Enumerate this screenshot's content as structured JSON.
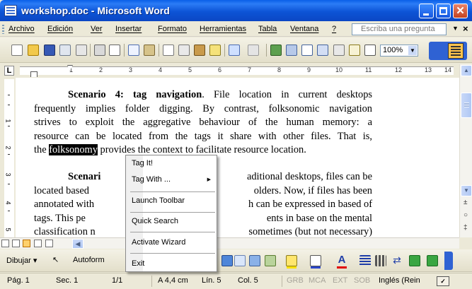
{
  "window": {
    "title": "workshop.doc - Microsoft Word"
  },
  "menubar": {
    "items": [
      "Archivo",
      "Edición",
      "Ver",
      "Insertar",
      "Formato",
      "Herramientas",
      "Tabla",
      "Ventana",
      "?"
    ],
    "ask_placeholder": "Escriba una pregunta"
  },
  "toolbar": {
    "zoom": "100%"
  },
  "ruler": {
    "numbers": [
      "1",
      "2",
      "3",
      "4",
      "5",
      "6",
      "7",
      "8",
      "9",
      "10",
      "11",
      "12",
      "13",
      "14"
    ]
  },
  "vruler": {
    "numbers": [
      "1",
      "2",
      "3",
      "4",
      "5"
    ]
  },
  "document": {
    "p1": {
      "heading": "Scenario 4: tag navigation",
      "line1_rest": ". File location in current desktops",
      "line2": "frequently implies folder digging. By contrast, folksonomic navigation",
      "line3": "strives to exploit the aggregative behaviour of the human memory: a",
      "line4": "resource can be located from the tags it share with other files. That is,",
      "line5_pre": "the ",
      "line5_sel": "folksonomy",
      "line5_post": " provides the context to facilitate resource location."
    },
    "p2": {
      "line1_head": "Scenari",
      "line1_tail": "aditional desktops, files can be",
      "line2_head": "located based",
      "line2_tail": "olders. Now, if files has been",
      "line3_head": "annotated with",
      "line3_tail": "h can be expressed in based of",
      "line4_head": "tags. This pe",
      "line4_tail": "ents in base on the mental",
      "line5_head": "classification n",
      "line5_tail": "sometimes (but not necessary)"
    }
  },
  "context_menu": {
    "items": [
      "Tag It!",
      "Tag With ...",
      "Launch Toolbar",
      "Quick Search",
      "Activate Wizard",
      "Exit"
    ]
  },
  "drawbar": {
    "draw_label": "Dibujar",
    "autoshapes_label": "Autoform"
  },
  "statusbar": {
    "page": "Pág. 1",
    "section": "Sec. 1",
    "pages": "1/1",
    "at": "A 4,4 cm",
    "line": "Lín. 5",
    "col": "Col. 5",
    "grb": "GRB",
    "mca": "MCA",
    "ext": "EXT",
    "sob": "SOB",
    "language": "Inglés (Rein"
  },
  "colors": {
    "titlebar": "#0b52d8",
    "selection": "#000000",
    "menu_band": "#f0f0f0"
  }
}
